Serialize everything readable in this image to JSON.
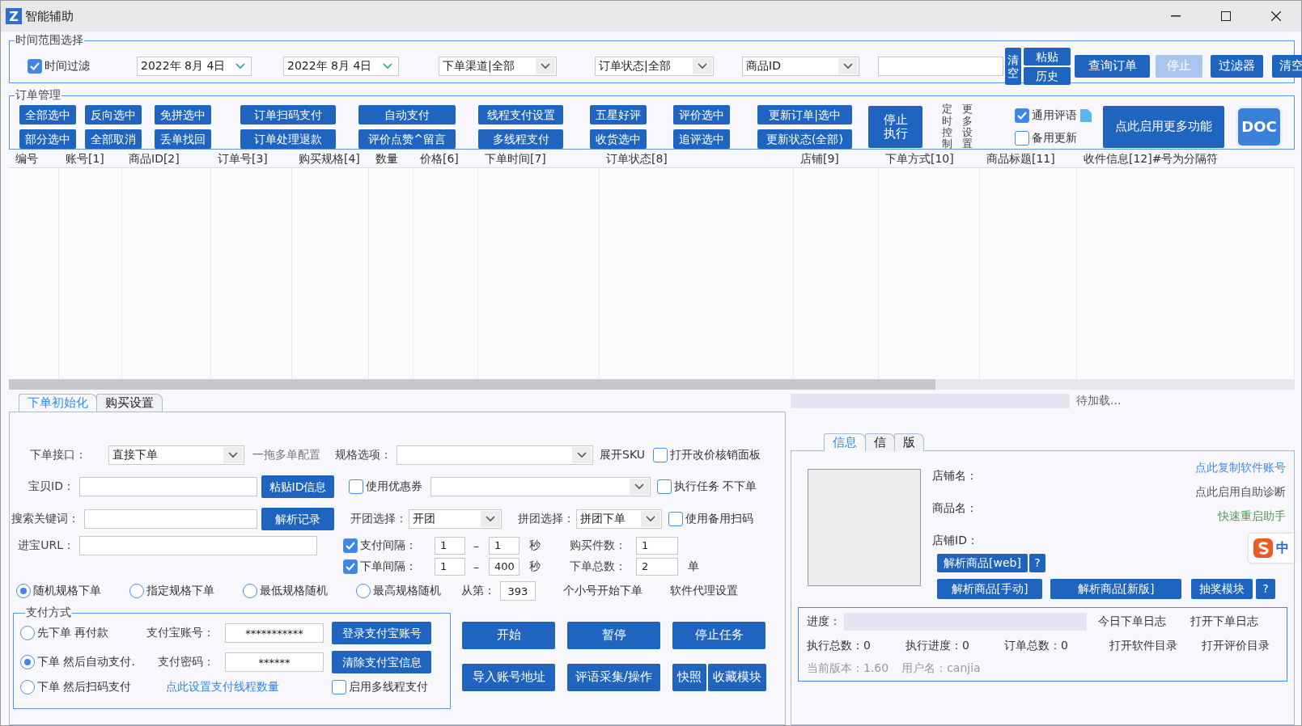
{
  "window": {
    "logo": "Z",
    "title": "智能辅助"
  },
  "time_range": {
    "legend": "时间范围选择",
    "time_filter": {
      "label": "时间过滤",
      "checked": true
    },
    "start_date": "2022年 8月 4日",
    "end_date": "2022年 8月 4日",
    "channel_select": "下单渠道|全部",
    "status_select": "订单状态|全部",
    "field_select": "商品ID",
    "clear_vertical": "清空",
    "paste": "粘贴",
    "history": "历史",
    "actions": [
      {
        "label": "查询订单",
        "disabled": false
      },
      {
        "label": "停止",
        "disabled": true
      },
      {
        "label": "过滤器",
        "disabled": false
      },
      {
        "label": "清空",
        "disabled": false
      }
    ]
  },
  "order_management": {
    "legend": "订单管理",
    "button_columns": [
      [
        "全部选中",
        "部分选中"
      ],
      [
        "反向选中",
        "全部取消"
      ],
      [
        "免拼选中",
        "丢单找回"
      ],
      [
        "订单扫码支付",
        "订单处理退款"
      ],
      [
        "自动支付",
        "评价点赞^留言"
      ],
      [
        "线程支付设置",
        "多线程支付"
      ],
      [
        "五星好评",
        "收货选中"
      ],
      [
        "评价选中",
        "追评选中"
      ],
      [
        "更新订单|选中",
        "更新状态(全部)"
      ]
    ],
    "stop_execute": "停止执行",
    "timer_control": "定时控制",
    "more_settings": "更多设置",
    "options": [
      {
        "label": "通用评语",
        "checked": true
      },
      {
        "label": "备用更新",
        "checked": false
      }
    ],
    "enable_more": "点此启用更多功能",
    "doc": "DOC"
  },
  "table": {
    "columns": [
      "编号",
      "账号[1]",
      "商品ID[2]",
      "订单号[3]",
      "购买规格[4]",
      "数量",
      "价格[6]",
      "下单时间[7]",
      "订单状态[8]",
      "店铺[9]",
      "下单方式[10]",
      "商品标题[11]",
      "收件信息[12]#号为分隔符"
    ]
  },
  "order_tabs": [
    {
      "label": "下单初始化",
      "selected": true
    },
    {
      "label": "购买设置",
      "selected": false
    }
  ],
  "order_form": {
    "interface_label": "下单接口：",
    "interface_value": "直接下单",
    "multi_config": "一拖多单配置",
    "spec_label": "规格选项：",
    "expand_sku": "展开SKU",
    "open_price_panel": {
      "label": "打开改价核销面板",
      "checked": false
    },
    "item_id_label": "宝贝ID：",
    "paste_id": "粘贴ID信息",
    "use_coupon": {
      "label": "使用优惠券",
      "checked": false
    },
    "run_no_order": {
      "label": "执行任务 不下单",
      "checked": false
    },
    "keyword_label": "搜索关键词：",
    "parse_record": "解析记录",
    "group_open_label": "开团选择：",
    "group_open_value": "开团",
    "group_join_label": "拼团选择：",
    "group_join_value": "拼团下单",
    "backup_scan": {
      "label": "使用备用扫码",
      "checked": false
    },
    "url_label": "进宝URL：",
    "intervals": [
      {
        "label": "支付间隔：",
        "checked": true,
        "from": "1",
        "to": "1",
        "unit": "秒",
        "count_label": "购买件数：",
        "count": "1"
      },
      {
        "label": "下单间隔：",
        "checked": true,
        "from": "1",
        "to": "400",
        "unit": "秒",
        "count_label": "下单总数：",
        "count": "2",
        "count_unit": "单"
      }
    ],
    "dash": "–",
    "spec_modes": [
      {
        "label": "随机规格下单",
        "selected": true
      },
      {
        "label": "指定规格下单",
        "selected": false
      },
      {
        "label": "最低规格随机",
        "selected": false
      },
      {
        "label": "最高规格随机",
        "selected": false
      }
    ],
    "from_label": "从第：",
    "from_value": "393",
    "from_suffix": "个小号开始下单",
    "agent_settings": "软件代理设置"
  },
  "payment": {
    "legend": "支付方式",
    "modes": [
      {
        "label": "先下单 再付款",
        "selected": false
      },
      {
        "label": "下单 然后自动支付.",
        "selected": true
      },
      {
        "label": "下单 然后扫码支付",
        "selected": false
      }
    ],
    "account_label": "支付宝账号：",
    "account_value": "***********",
    "password_label": "支付密码：",
    "password_value": "******",
    "login": "登录支付宝账号",
    "clear": "清除支付宝信息",
    "thread_link": "点此设置支付线程数量",
    "multi_thread": {
      "label": "启用多线程支付",
      "checked": false
    }
  },
  "task_buttons": [
    [
      "开始",
      "暂停",
      "停止任务"
    ],
    [
      "导入账号地址",
      "评语采集/操作",
      "快照",
      "收藏模块"
    ]
  ],
  "right_panel": {
    "loading": "待加载...",
    "tabs": [
      {
        "label": "信息",
        "selected": true
      },
      {
        "label": "信",
        "selected": false
      },
      {
        "label": "版",
        "selected": false
      }
    ],
    "fields": [
      "店铺名：",
      "商品名：",
      "店铺ID："
    ],
    "links": [
      {
        "label": "点此复制软件账号",
        "color": "#3b8ee8"
      },
      {
        "label": "点此启用自助诊断",
        "color": "#555555"
      },
      {
        "label": "快速重启助手",
        "color": "#4e9a52"
      }
    ],
    "ime": "中",
    "parse_web": "解析商品[web]",
    "help": "?",
    "parse_manual": "解析商品[手动]",
    "parse_new": "解析商品[新版]",
    "lottery": "抽奖模块",
    "progress": {
      "label": "进度：",
      "level": 0
    },
    "today_log": "今日下单日志",
    "open_log": "打开下单日志",
    "stats": [
      "执行总数：0",
      "执行进度：0",
      "订单总数：0"
    ],
    "open_software_dir": "打开软件目录",
    "open_review_dir": "打开评价目录",
    "version": "当前版本：1.60",
    "user": "用户名：canjia"
  }
}
